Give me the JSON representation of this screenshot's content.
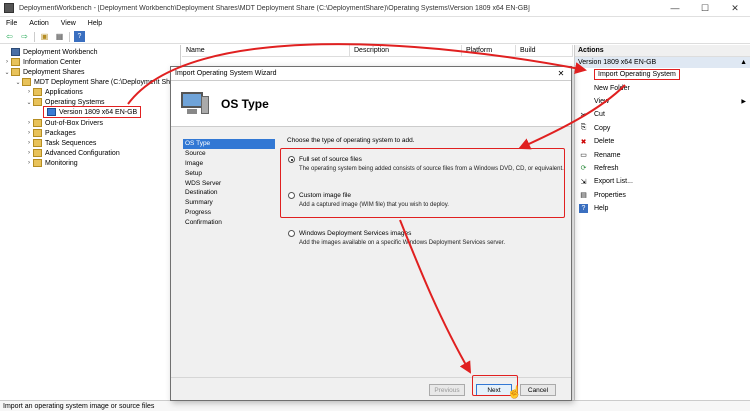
{
  "window": {
    "title": "DeploymentWorkbench - [Deployment Workbench\\Deployment Shares\\MDT Deployment Share (C:\\DeploymentShare)\\Operating Systems\\Version 1809 x64 EN-GB]",
    "controls": [
      "—",
      "☐",
      "✕"
    ]
  },
  "menu": [
    "File",
    "Action",
    "View",
    "Help"
  ],
  "tree": [
    {
      "label": "Deployment Workbench",
      "arrow": ""
    },
    {
      "label": "Information Center",
      "arrow": "›"
    },
    {
      "label": "Deployment Shares",
      "arrow": "⌄"
    },
    {
      "label": "MDT Deployment Share (C:\\Deployment Share",
      "arrow": "⌄"
    },
    {
      "label": "Applications",
      "arrow": "›"
    },
    {
      "label": "Operating Systems",
      "arrow": "⌄"
    },
    {
      "label": "Version 1809 x64 EN-GB",
      "arrow": ""
    },
    {
      "label": "Out-of-Box Drivers",
      "arrow": "›"
    },
    {
      "label": "Packages",
      "arrow": "›"
    },
    {
      "label": "Task Sequences",
      "arrow": "›"
    },
    {
      "label": "Advanced Configuration",
      "arrow": "›"
    },
    {
      "label": "Monitoring",
      "arrow": "›"
    }
  ],
  "list_columns": [
    "Name",
    "Description",
    "Platform",
    "Build"
  ],
  "actions": {
    "header": "Actions",
    "context": "Version 1809 x64 EN-GB",
    "items": [
      {
        "label": "Import Operating System",
        "icon": ""
      },
      {
        "label": "New Folder",
        "icon": ""
      },
      {
        "label": "View",
        "icon": ""
      },
      {
        "label": "Cut",
        "icon": "✂"
      },
      {
        "label": "Copy",
        "icon": "⎘"
      },
      {
        "label": "Delete",
        "icon": "✖"
      },
      {
        "label": "Rename",
        "icon": "▭"
      },
      {
        "label": "Refresh",
        "icon": "⟳"
      },
      {
        "label": "Export List...",
        "icon": "⇲"
      },
      {
        "label": "Properties",
        "icon": "▤"
      },
      {
        "label": "Help",
        "icon": "?"
      }
    ]
  },
  "dialog": {
    "title": "Import Operating System Wizard",
    "close": "✕",
    "heading": "OS Type",
    "steps": [
      "OS Type",
      "Source",
      "Image",
      "Setup",
      "WDS Server",
      "Destination",
      "Summary",
      "Progress",
      "Confirmation"
    ],
    "prompt": "Choose the type of operating system to add.",
    "options": [
      {
        "label": "Full set of source files",
        "desc": "The operating system being added consists of source files from a Windows DVD, CD, or equivalent.",
        "selected": true
      },
      {
        "label": "Custom image file",
        "desc": "Add a captured image (WIM file) that you wish to deploy.",
        "selected": false
      },
      {
        "label": "Windows Deployment Services images",
        "desc": "Add the images available on a specific Windows Deployment Services server.",
        "selected": false
      }
    ],
    "buttons": {
      "previous": "Previous",
      "next": "Next",
      "cancel": "Cancel"
    }
  },
  "status": "Import an operating system image or source files",
  "colors": {
    "highlight": "#e02020",
    "selection": "#3278d4"
  }
}
